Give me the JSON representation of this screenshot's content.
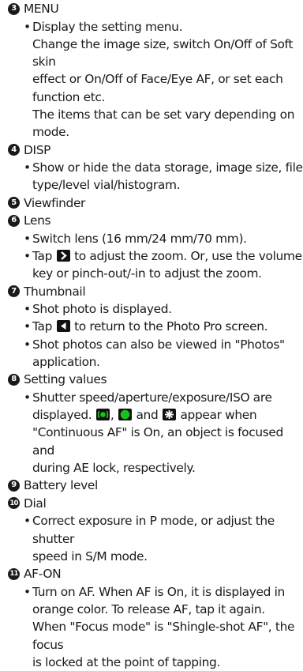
{
  "items": [
    {
      "num": "3",
      "title": "MENU",
      "bullet": "Display the setting menu.",
      "cont": [
        "Change the image size, switch On/Off of Soft skin",
        "effect or On/Off of Face/Eye AF, or set each",
        "function etc.",
        "The items that can be set vary depending on",
        "mode."
      ]
    },
    {
      "num": "4",
      "title": "DISP",
      "bullet1": "Show or hide the data storage, image size, file",
      "bullet1_cont": "type/level vial/histogram."
    },
    {
      "num": "5",
      "title": "Viewfinder"
    },
    {
      "num": "6",
      "title": "Lens",
      "bullet1": "Switch lens (16 mm/24 mm/70 mm).",
      "bullet2_pre": "Tap",
      "bullet2_post": "to adjust the zoom. Or, use the volume",
      "bullet2_cont": "key or pinch-out/-in to adjust the zoom."
    },
    {
      "num": "7",
      "title": "Thumbnail",
      "bullet1": "Shot photo is displayed.",
      "bullet2_pre": "Tap",
      "bullet2_post": "to return to the Photo Pro screen.",
      "bullet3": "Shot photos can also be viewed in \"Photos\"",
      "bullet3_cont": "application."
    },
    {
      "num": "8",
      "title": "Setting values",
      "bullet1": "Shutter speed/aperture/exposure/ISO are",
      "line2_pre": "displayed.",
      "line2_mid1": ",",
      "line2_mid2": "and",
      "line2_post": "appear when",
      "line3": "\"Continuous AF\" is On, an object is focused and",
      "line4": "during AE lock, respectively."
    },
    {
      "num": "9",
      "title": "Battery level"
    },
    {
      "num": "10",
      "title": "Dial",
      "bullet1": "Correct exposure in P mode, or adjust the shutter",
      "bullet1_cont": "speed in S/M mode."
    },
    {
      "num": "11",
      "title": "AF-ON",
      "bullet1": "Turn on AF. When AF is On, it is displayed in",
      "cont": [
        "orange color. To release AF, tap it again.",
        "When \"Focus mode\" is \"Shingle-shot AF\", the focus",
        "is locked at the point of tapping."
      ]
    }
  ],
  "icons": {
    "zoom": "chevron-right-icon",
    "back": "triangle-left-icon",
    "continuous_af": "continuous-af-icon",
    "focused": "focus-dot-icon",
    "ae_lock": "ae-lock-icon",
    "green": "#19c219"
  }
}
